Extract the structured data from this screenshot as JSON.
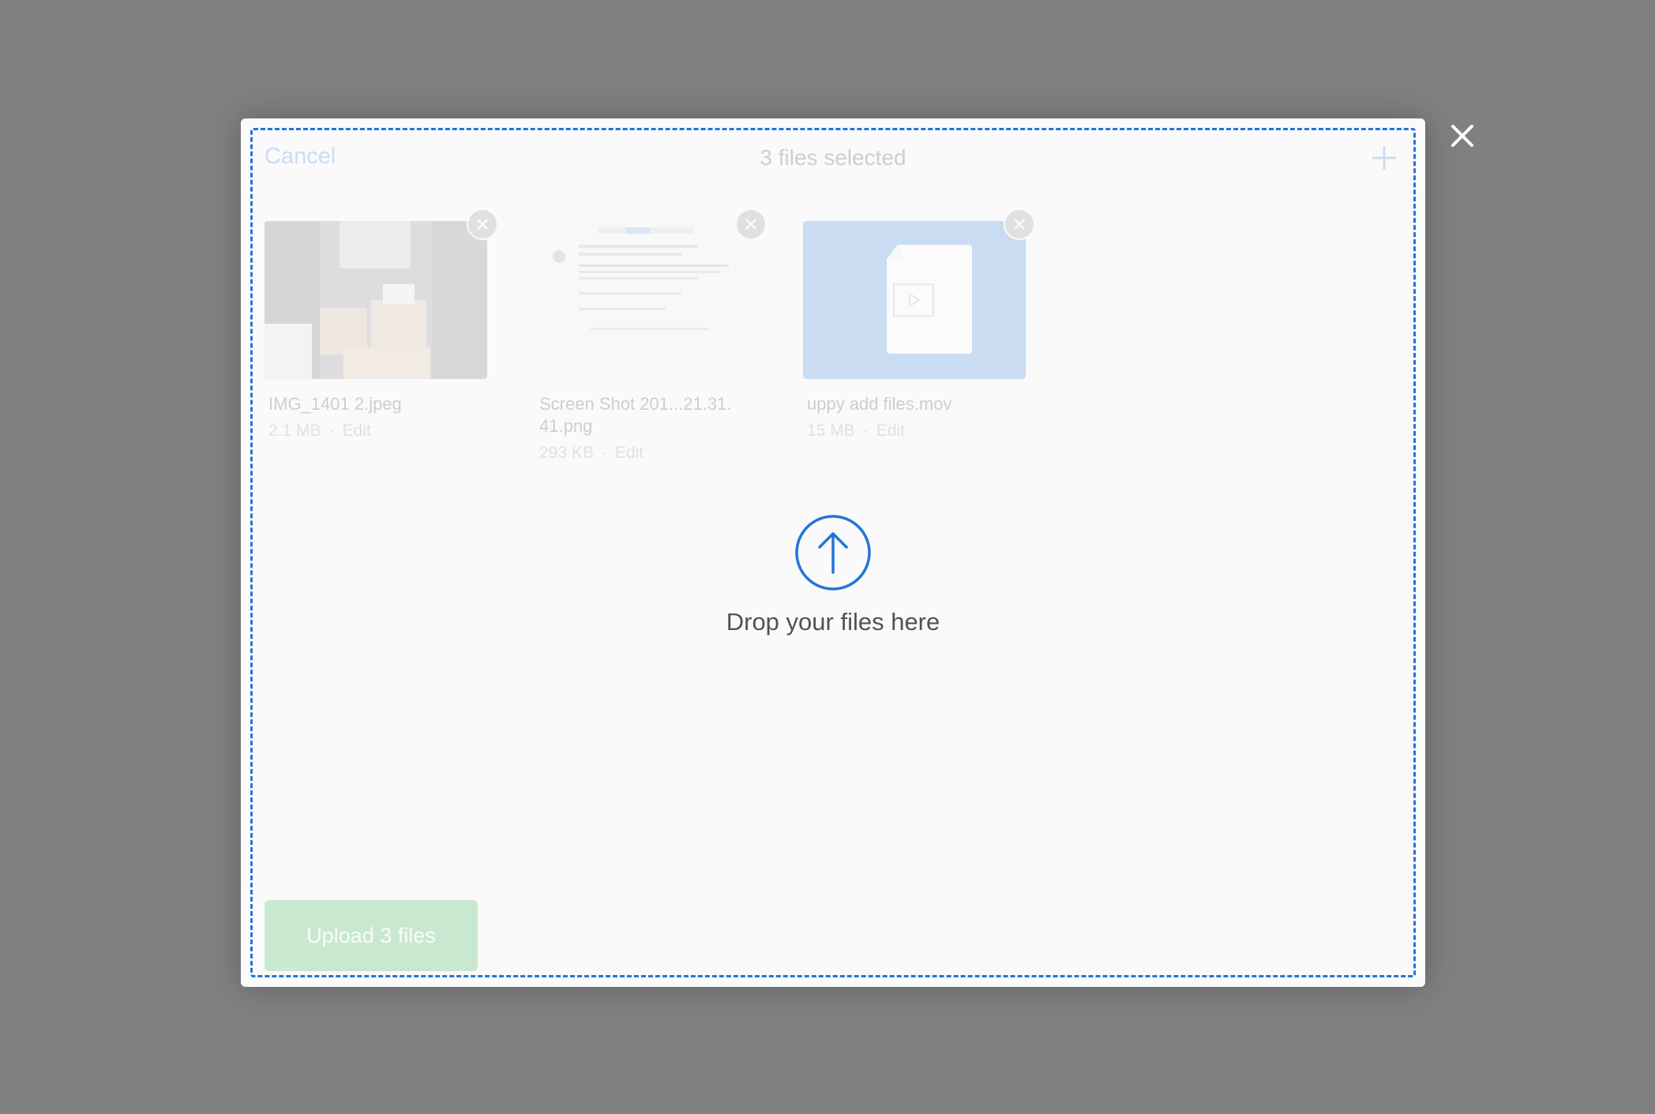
{
  "header": {
    "cancel_label": "Cancel",
    "title": "3 files selected",
    "add_icon": "plus-icon"
  },
  "files": [
    {
      "name": "IMG_1401 2.jpeg",
      "size": "2.1 MB",
      "edit": "Edit",
      "thumb": "photo"
    },
    {
      "name": "Screen Shot 201...21.31.\n41.png",
      "size": "293 KB",
      "edit": "Edit",
      "thumb": "screenshot"
    },
    {
      "name": "uppy add files.mov",
      "size": "15 MB",
      "edit": "Edit",
      "thumb": "video-file-icon"
    }
  ],
  "footer": {
    "upload_label": "Upload 3 files"
  },
  "dropzone": {
    "text": "Drop your files here",
    "icon": "upload-arrow-icon"
  },
  "colors": {
    "accent": "#2275d7",
    "upload": "#1bb240",
    "overlay": "#808080"
  }
}
